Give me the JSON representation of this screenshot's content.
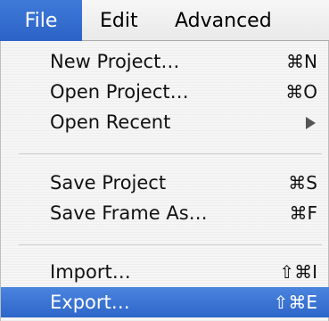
{
  "menubar": {
    "file": "File",
    "edit": "Edit",
    "advanced": "Advanced"
  },
  "file_menu": {
    "new_project": {
      "label": "New Project…",
      "shortcut": "⌘N"
    },
    "open_project": {
      "label": "Open Project…",
      "shortcut": "⌘O"
    },
    "open_recent": {
      "label": "Open Recent",
      "submenu_icon": "right-arrow-icon"
    },
    "save_project": {
      "label": "Save Project",
      "shortcut": "⌘S"
    },
    "save_frame_as": {
      "label": "Save Frame As…",
      "shortcut": "⌘F"
    },
    "import": {
      "label": "Import…",
      "shortcut": "⇧⌘I"
    },
    "export": {
      "label": "Export…",
      "shortcut": "⇧⌘E"
    }
  },
  "colors": {
    "highlight": "#2d66c9",
    "menu_background": "#f6f6f6"
  }
}
